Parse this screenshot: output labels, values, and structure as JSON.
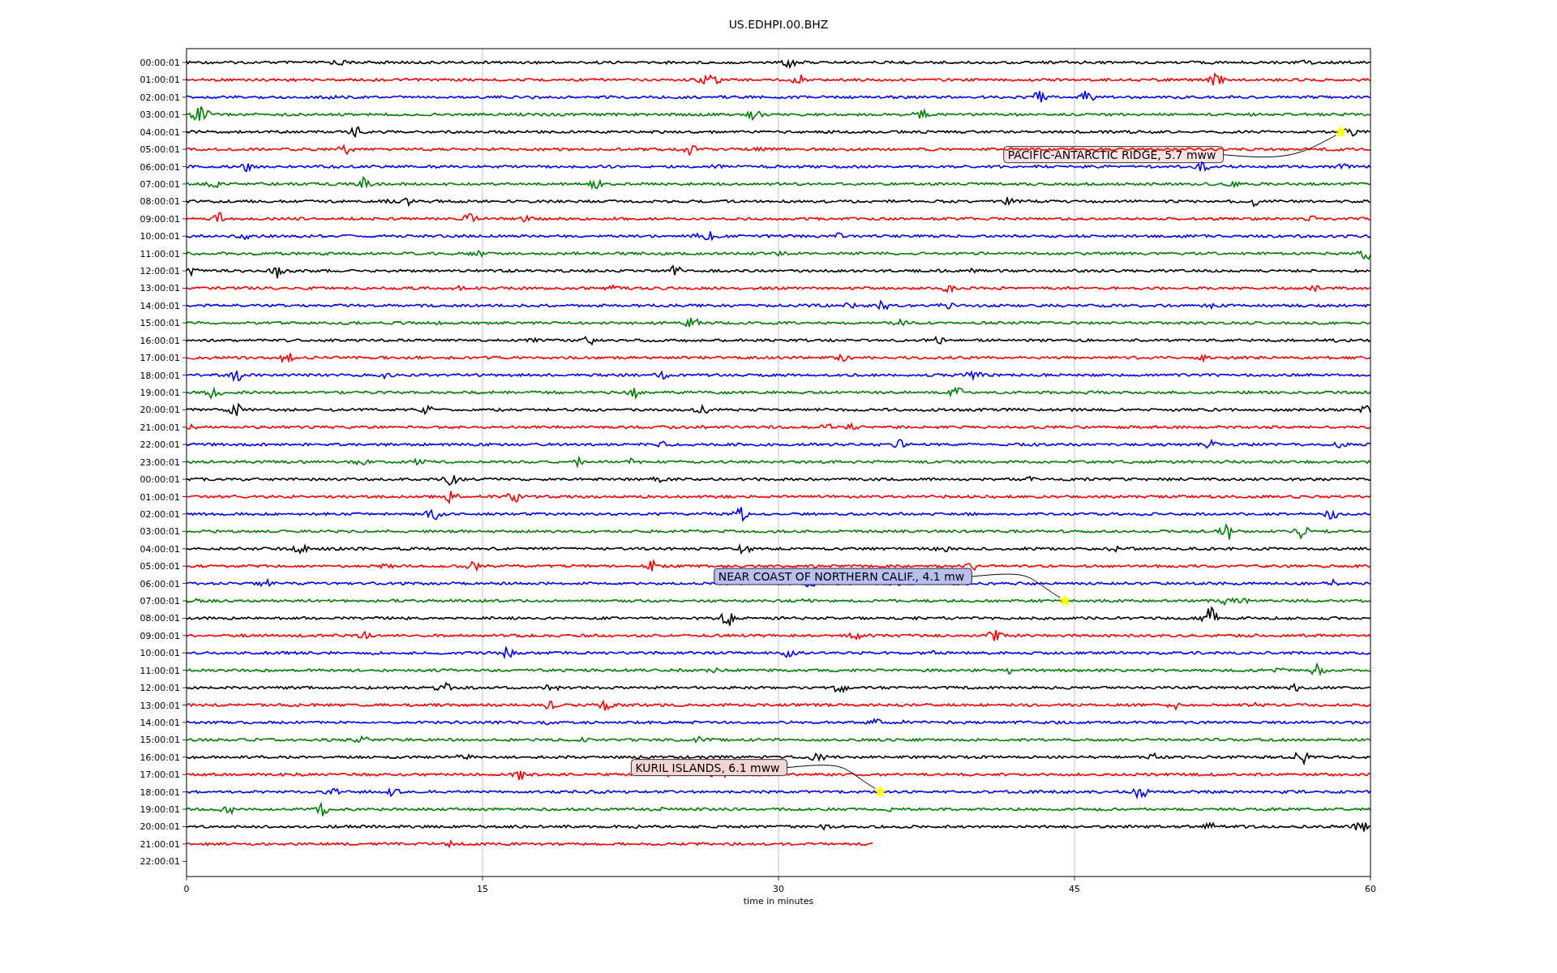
{
  "title": "US.EDHPI.00.BHZ",
  "plot": {
    "xlabel": "time in minutes",
    "xticks": [
      "0",
      "15",
      "30",
      "45",
      "60"
    ],
    "rows": [
      {
        "label": "00:00:01",
        "trace": {
          "color": "#000000",
          "level": 1
        }
      },
      {
        "label": "01:00:01",
        "trace": {
          "color": "#ff0000",
          "level": 1
        }
      },
      {
        "label": "02:00:01",
        "trace": {
          "color": "#0000ff",
          "level": 1
        }
      },
      {
        "label": "03:00:01",
        "trace": {
          "color": "#008000",
          "level": 1
        }
      },
      {
        "label": "04:00:01",
        "trace": {
          "color": "#000000",
          "level": 1,
          "event": {
            "label": "PACIFIC-ANTARCTIC RIDGE, 5.7 mww",
            "color": "#fbe3e3",
            "level": 0.975
          }
        }
      },
      {
        "label": "05:00:01",
        "trace": {
          "color": "#ff0000",
          "level": 1
        }
      },
      {
        "label": "06:00:01",
        "trace": {
          "color": "#0000ff",
          "level": 1
        }
      },
      {
        "label": "07:00:01",
        "trace": {
          "color": "#008000",
          "level": 1
        }
      },
      {
        "label": "08:00:01",
        "trace": {
          "color": "#000000",
          "level": 1
        }
      },
      {
        "label": "09:00:01",
        "trace": {
          "color": "#ff0000",
          "level": 1
        }
      },
      {
        "label": "10:00:01",
        "trace": {
          "color": "#0000ff",
          "level": 1
        }
      },
      {
        "label": "11:00:01",
        "trace": {
          "color": "#008000",
          "level": 1
        }
      },
      {
        "label": "12:00:01",
        "trace": {
          "color": "#000000",
          "level": 1
        }
      },
      {
        "label": "13:00:01",
        "trace": {
          "color": "#ff0000",
          "level": 1
        }
      },
      {
        "label": "14:00:01",
        "trace": {
          "color": "#0000ff",
          "level": 1
        }
      },
      {
        "label": "15:00:01",
        "trace": {
          "color": "#008000",
          "level": 1
        }
      },
      {
        "label": "16:00:01",
        "trace": {
          "color": "#000000",
          "level": 1
        }
      },
      {
        "label": "17:00:01",
        "trace": {
          "color": "#ff0000",
          "level": 1
        }
      },
      {
        "label": "18:00:01",
        "trace": {
          "color": "#0000ff",
          "level": 1
        }
      },
      {
        "label": "19:00:01",
        "trace": {
          "color": "#008000",
          "level": 1
        }
      },
      {
        "label": "20:00:01",
        "trace": {
          "color": "#000000",
          "level": 1
        }
      },
      {
        "label": "21:00:01",
        "trace": {
          "color": "#ff0000",
          "level": 1
        }
      },
      {
        "label": "22:00:01",
        "trace": {
          "color": "#0000ff",
          "level": 1
        }
      },
      {
        "label": "23:00:01",
        "trace": {
          "color": "#008000",
          "level": 1
        }
      },
      {
        "label": "00:00:01",
        "trace": {
          "color": "#000000",
          "level": 1
        }
      },
      {
        "label": "01:00:01",
        "trace": {
          "color": "#ff0000",
          "level": 1
        }
      },
      {
        "label": "02:00:01",
        "trace": {
          "color": "#0000ff",
          "level": 1
        }
      },
      {
        "label": "03:00:01",
        "trace": {
          "color": "#008000",
          "level": 1
        }
      },
      {
        "label": "04:00:01",
        "trace": {
          "color": "#000000",
          "level": 1
        }
      },
      {
        "label": "05:00:01",
        "trace": {
          "color": "#ff0000",
          "level": 1
        }
      },
      {
        "label": "06:00:01",
        "trace": {
          "color": "#0000ff",
          "level": 1
        }
      },
      {
        "label": "07:00:01",
        "trace": {
          "color": "#008000",
          "level": 1,
          "event": {
            "label": "NEAR COAST OF NORTHERN CALIF., 4.1 mw",
            "color": "#b9bfee",
            "level": 0.742
          }
        }
      },
      {
        "label": "08:00:01",
        "trace": {
          "color": "#000000",
          "level": 1
        }
      },
      {
        "label": "09:00:01",
        "trace": {
          "color": "#ff0000",
          "level": 1
        }
      },
      {
        "label": "10:00:01",
        "trace": {
          "color": "#0000ff",
          "level": 1
        }
      },
      {
        "label": "11:00:01",
        "trace": {
          "color": "#008000",
          "level": 1
        }
      },
      {
        "label": "12:00:01",
        "trace": {
          "color": "#000000",
          "level": 1
        }
      },
      {
        "label": "13:00:01",
        "trace": {
          "color": "#ff0000",
          "level": 1
        }
      },
      {
        "label": "14:00:01",
        "trace": {
          "color": "#0000ff",
          "level": 1
        }
      },
      {
        "label": "15:00:01",
        "trace": {
          "color": "#008000",
          "level": 1
        }
      },
      {
        "label": "16:00:01",
        "trace": {
          "color": "#000000",
          "level": 1
        }
      },
      {
        "label": "17:00:01",
        "trace": {
          "color": "#ff0000",
          "level": 1
        }
      },
      {
        "label": "18:00:01",
        "trace": {
          "color": "#0000ff",
          "level": 1,
          "event": {
            "label": "KURIL ISLANDS, 6.1 mww",
            "color": "#f3d5d5",
            "level": 0.586
          }
        }
      },
      {
        "label": "19:00:01",
        "trace": {
          "color": "#008000",
          "level": 1
        }
      },
      {
        "label": "20:00:01",
        "trace": {
          "color": "#000000",
          "level": 1
        }
      },
      {
        "label": "21:00:01",
        "trace": {
          "color": "#ff0000",
          "level": 0.58
        }
      },
      {
        "label": "22:00:01"
      }
    ]
  }
}
